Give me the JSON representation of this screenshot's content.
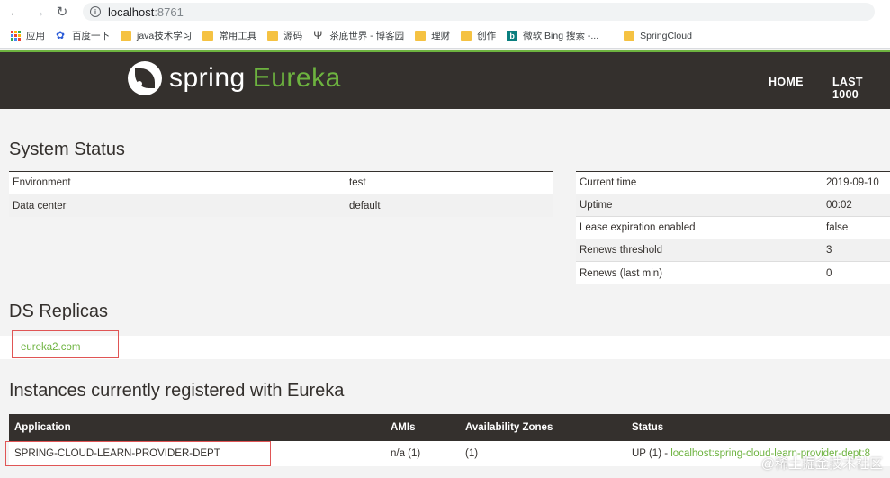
{
  "browser": {
    "back_icon": "arrow-left-icon",
    "forward_icon": "arrow-right-icon",
    "reload_icon": "reload-icon",
    "url_host": "localhost",
    "url_port": ":8761",
    "bookmarks": [
      {
        "label": "应用",
        "icon": "apps-grid-icon"
      },
      {
        "label": "百度一下",
        "icon": "baidu-paw-icon"
      },
      {
        "label": "java技术学习",
        "icon": "folder-icon"
      },
      {
        "label": "常用工具",
        "icon": "folder-icon"
      },
      {
        "label": "源码",
        "icon": "folder-icon"
      },
      {
        "label": "茶底世界 - 博客园",
        "icon": "blog-icon"
      },
      {
        "label": "理财",
        "icon": "folder-icon"
      },
      {
        "label": "创作",
        "icon": "folder-icon"
      },
      {
        "label": "微软 Bing 搜索 -...",
        "icon": "bing-icon"
      },
      {
        "label": "SpringCloud",
        "icon": "folder-icon"
      }
    ]
  },
  "header": {
    "logo_spring": "spring",
    "logo_eureka": "Eureka",
    "nav_home": "HOME",
    "nav_last": "LAST 1000"
  },
  "system_status": {
    "title": "System Status",
    "left": [
      {
        "label": "Environment",
        "value": "test"
      },
      {
        "label": "Data center",
        "value": "default"
      }
    ],
    "right": [
      {
        "label": "Current time",
        "value": "2019-09-10"
      },
      {
        "label": "Uptime",
        "value": "00:02"
      },
      {
        "label": "Lease expiration enabled",
        "value": "false"
      },
      {
        "label": "Renews threshold",
        "value": "3"
      },
      {
        "label": "Renews (last min)",
        "value": "0"
      }
    ]
  },
  "ds_replicas": {
    "title": "DS Replicas",
    "link": "eureka2.com"
  },
  "instances": {
    "title": "Instances currently registered with Eureka",
    "headers": [
      "Application",
      "AMIs",
      "Availability Zones",
      "Status"
    ],
    "rows": [
      {
        "application": "SPRING-CLOUD-LEARN-PROVIDER-DEPT",
        "amis": "n/a (1)",
        "zones": "(1)",
        "status_prefix": "UP (1) - ",
        "status_link": "localhost:spring-cloud-learn-provider-dept:8"
      }
    ]
  },
  "watermark": "@稀土掘金技术社区",
  "colors": {
    "accent": "#6db33f",
    "header_bg": "#34302d",
    "highlight_box": "#e05555"
  }
}
